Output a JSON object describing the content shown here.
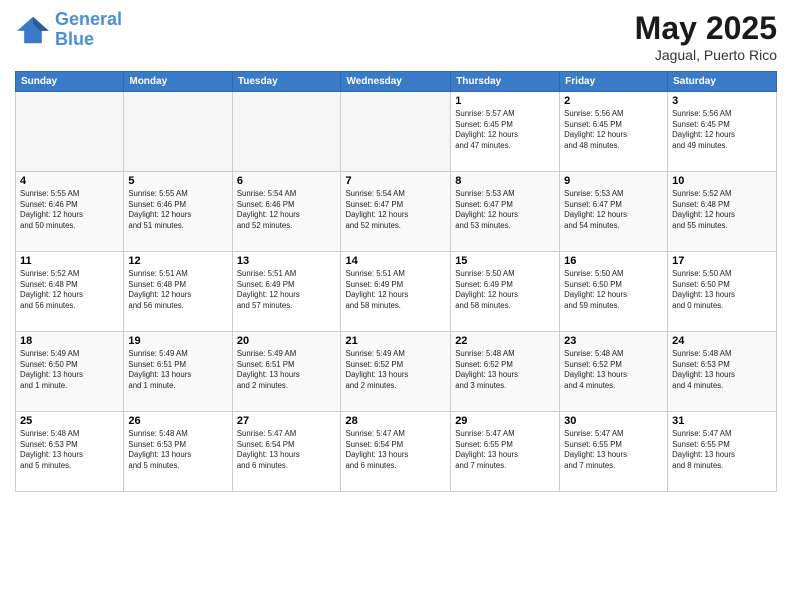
{
  "logo": {
    "line1": "General",
    "line2": "Blue"
  },
  "title": "May 2025",
  "subtitle": "Jagual, Puerto Rico",
  "days_of_week": [
    "Sunday",
    "Monday",
    "Tuesday",
    "Wednesday",
    "Thursday",
    "Friday",
    "Saturday"
  ],
  "weeks": [
    [
      {
        "day": "",
        "info": ""
      },
      {
        "day": "",
        "info": ""
      },
      {
        "day": "",
        "info": ""
      },
      {
        "day": "",
        "info": ""
      },
      {
        "day": "1",
        "info": "Sunrise: 5:57 AM\nSunset: 6:45 PM\nDaylight: 12 hours\nand 47 minutes."
      },
      {
        "day": "2",
        "info": "Sunrise: 5:56 AM\nSunset: 6:45 PM\nDaylight: 12 hours\nand 48 minutes."
      },
      {
        "day": "3",
        "info": "Sunrise: 5:56 AM\nSunset: 6:45 PM\nDaylight: 12 hours\nand 49 minutes."
      }
    ],
    [
      {
        "day": "4",
        "info": "Sunrise: 5:55 AM\nSunset: 6:46 PM\nDaylight: 12 hours\nand 50 minutes."
      },
      {
        "day": "5",
        "info": "Sunrise: 5:55 AM\nSunset: 6:46 PM\nDaylight: 12 hours\nand 51 minutes."
      },
      {
        "day": "6",
        "info": "Sunrise: 5:54 AM\nSunset: 6:46 PM\nDaylight: 12 hours\nand 52 minutes."
      },
      {
        "day": "7",
        "info": "Sunrise: 5:54 AM\nSunset: 6:47 PM\nDaylight: 12 hours\nand 52 minutes."
      },
      {
        "day": "8",
        "info": "Sunrise: 5:53 AM\nSunset: 6:47 PM\nDaylight: 12 hours\nand 53 minutes."
      },
      {
        "day": "9",
        "info": "Sunrise: 5:53 AM\nSunset: 6:47 PM\nDaylight: 12 hours\nand 54 minutes."
      },
      {
        "day": "10",
        "info": "Sunrise: 5:52 AM\nSunset: 6:48 PM\nDaylight: 12 hours\nand 55 minutes."
      }
    ],
    [
      {
        "day": "11",
        "info": "Sunrise: 5:52 AM\nSunset: 6:48 PM\nDaylight: 12 hours\nand 56 minutes."
      },
      {
        "day": "12",
        "info": "Sunrise: 5:51 AM\nSunset: 6:48 PM\nDaylight: 12 hours\nand 56 minutes."
      },
      {
        "day": "13",
        "info": "Sunrise: 5:51 AM\nSunset: 6:49 PM\nDaylight: 12 hours\nand 57 minutes."
      },
      {
        "day": "14",
        "info": "Sunrise: 5:51 AM\nSunset: 6:49 PM\nDaylight: 12 hours\nand 58 minutes."
      },
      {
        "day": "15",
        "info": "Sunrise: 5:50 AM\nSunset: 6:49 PM\nDaylight: 12 hours\nand 58 minutes."
      },
      {
        "day": "16",
        "info": "Sunrise: 5:50 AM\nSunset: 6:50 PM\nDaylight: 12 hours\nand 59 minutes."
      },
      {
        "day": "17",
        "info": "Sunrise: 5:50 AM\nSunset: 6:50 PM\nDaylight: 13 hours\nand 0 minutes."
      }
    ],
    [
      {
        "day": "18",
        "info": "Sunrise: 5:49 AM\nSunset: 6:50 PM\nDaylight: 13 hours\nand 1 minute."
      },
      {
        "day": "19",
        "info": "Sunrise: 5:49 AM\nSunset: 6:51 PM\nDaylight: 13 hours\nand 1 minute."
      },
      {
        "day": "20",
        "info": "Sunrise: 5:49 AM\nSunset: 6:51 PM\nDaylight: 13 hours\nand 2 minutes."
      },
      {
        "day": "21",
        "info": "Sunrise: 5:49 AM\nSunset: 6:52 PM\nDaylight: 13 hours\nand 2 minutes."
      },
      {
        "day": "22",
        "info": "Sunrise: 5:48 AM\nSunset: 6:52 PM\nDaylight: 13 hours\nand 3 minutes."
      },
      {
        "day": "23",
        "info": "Sunrise: 5:48 AM\nSunset: 6:52 PM\nDaylight: 13 hours\nand 4 minutes."
      },
      {
        "day": "24",
        "info": "Sunrise: 5:48 AM\nSunset: 6:53 PM\nDaylight: 13 hours\nand 4 minutes."
      }
    ],
    [
      {
        "day": "25",
        "info": "Sunrise: 5:48 AM\nSunset: 6:53 PM\nDaylight: 13 hours\nand 5 minutes."
      },
      {
        "day": "26",
        "info": "Sunrise: 5:48 AM\nSunset: 6:53 PM\nDaylight: 13 hours\nand 5 minutes."
      },
      {
        "day": "27",
        "info": "Sunrise: 5:47 AM\nSunset: 6:54 PM\nDaylight: 13 hours\nand 6 minutes."
      },
      {
        "day": "28",
        "info": "Sunrise: 5:47 AM\nSunset: 6:54 PM\nDaylight: 13 hours\nand 6 minutes."
      },
      {
        "day": "29",
        "info": "Sunrise: 5:47 AM\nSunset: 6:55 PM\nDaylight: 13 hours\nand 7 minutes."
      },
      {
        "day": "30",
        "info": "Sunrise: 5:47 AM\nSunset: 6:55 PM\nDaylight: 13 hours\nand 7 minutes."
      },
      {
        "day": "31",
        "info": "Sunrise: 5:47 AM\nSunset: 6:55 PM\nDaylight: 13 hours\nand 8 minutes."
      }
    ]
  ]
}
